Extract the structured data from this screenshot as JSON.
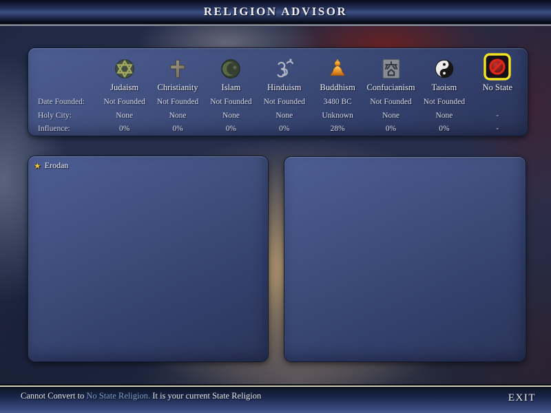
{
  "window": {
    "title": "RELIGION ADVISOR"
  },
  "religion_table": {
    "row_labels": {
      "date_founded": "Date Founded:",
      "holy_city": "Holy City:",
      "influence": "Influence:"
    },
    "religions": [
      {
        "name": "Judaism",
        "icon": "star-of-david-icon",
        "date_founded": "Not Founded",
        "holy_city": "None",
        "influence": "0%",
        "selected": false
      },
      {
        "name": "Christianity",
        "icon": "christian-cross-icon",
        "date_founded": "Not Founded",
        "holy_city": "None",
        "influence": "0%",
        "selected": false
      },
      {
        "name": "Islam",
        "icon": "crescent-and-star-icon",
        "date_founded": "Not Founded",
        "holy_city": "None",
        "influence": "0%",
        "selected": false
      },
      {
        "name": "Hinduism",
        "icon": "om-icon",
        "date_founded": "Not Founded",
        "holy_city": "None",
        "influence": "0%",
        "selected": false
      },
      {
        "name": "Buddhism",
        "icon": "buddha-icon",
        "date_founded": "3480 BC",
        "holy_city": "Unknown",
        "influence": "28%",
        "selected": false
      },
      {
        "name": "Confucianism",
        "icon": "confucian-glyph-icon",
        "date_founded": "Not Founded",
        "holy_city": "None",
        "influence": "0%",
        "selected": false
      },
      {
        "name": "Taoism",
        "icon": "yin-yang-icon",
        "date_founded": "Not Founded",
        "holy_city": "None",
        "influence": "0%",
        "selected": false
      },
      {
        "name": "No State",
        "icon": "no-state-icon",
        "date_founded": "",
        "holy_city": "-",
        "influence": "-",
        "selected": true
      }
    ]
  },
  "civ_list_panel": {
    "entries": [
      {
        "name": "Erodan",
        "icon": "favorite-star-icon",
        "star_glyph": "★"
      }
    ]
  },
  "status_bar": {
    "message_prefix": "Cannot Convert to ",
    "message_link": "No State Religion.",
    "message_suffix": " It is your current State Religion",
    "exit_label": "EXIT"
  },
  "colors": {
    "selection_highlight": "#f2e41e",
    "status_link": "#7fa2c6",
    "favorite_star_gold": "#f2c53d",
    "panel_blue_top": "#4d5e95",
    "panel_blue_bottom": "#2b3559"
  }
}
